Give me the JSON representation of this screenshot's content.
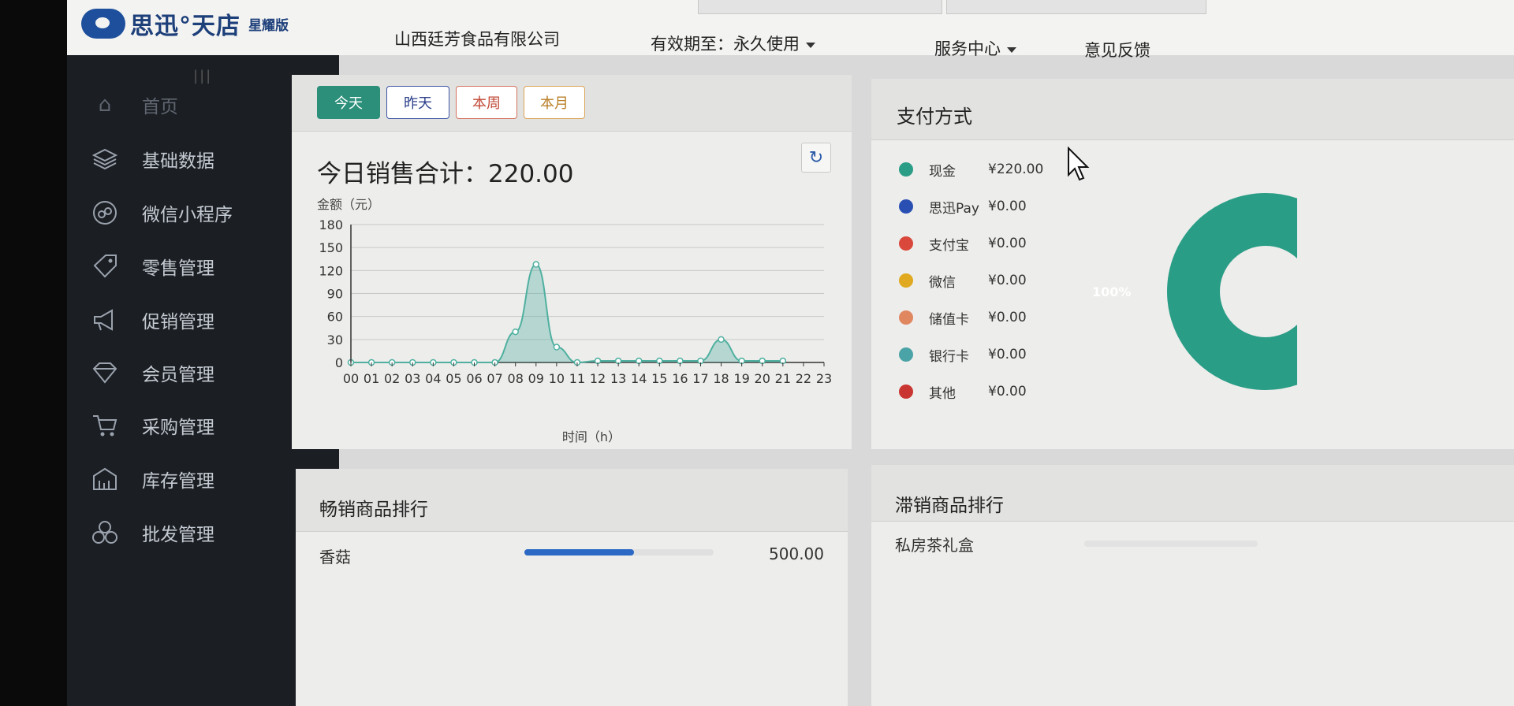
{
  "header": {
    "brand": "思迅°天店",
    "edition": "星耀版",
    "company": "山西廷芳食品有限公司",
    "validity_label": "有效期至：",
    "validity_value": "永久使用",
    "service_center": "服务中心",
    "feedback": "意见反馈"
  },
  "sidebar": {
    "items": [
      {
        "label": "首页",
        "icon": "home-icon"
      },
      {
        "label": "基础数据",
        "icon": "layers-icon"
      },
      {
        "label": "微信小程序",
        "icon": "miniprogram-icon"
      },
      {
        "label": "零售管理",
        "icon": "tag-icon"
      },
      {
        "label": "促销管理",
        "icon": "megaphone-icon"
      },
      {
        "label": "会员管理",
        "icon": "diamond-icon"
      },
      {
        "label": "采购管理",
        "icon": "cart-icon"
      },
      {
        "label": "库存管理",
        "icon": "warehouse-icon"
      },
      {
        "label": "批发管理",
        "icon": "cubes-icon"
      }
    ]
  },
  "sales": {
    "period_buttons": [
      "今天",
      "昨天",
      "本周",
      "本月"
    ],
    "selected_period": "今天",
    "total_label": "今日销售合计：",
    "total_value": "220.00"
  },
  "chart_data": {
    "type": "area",
    "ylabel": "金额（元）",
    "xlabel": "时间（h）",
    "ylim": [
      0,
      180
    ],
    "yticks": [
      0,
      30,
      60,
      90,
      120,
      150,
      180
    ],
    "categories": [
      "00",
      "01",
      "02",
      "03",
      "04",
      "05",
      "06",
      "07",
      "08",
      "09",
      "10",
      "11",
      "12",
      "13",
      "14",
      "15",
      "16",
      "17",
      "18",
      "19",
      "20",
      "21",
      "22",
      "23"
    ],
    "series": [
      {
        "values": [
          0,
          0,
          0,
          0,
          0,
          0,
          0,
          0,
          40,
          128,
          20,
          0,
          2,
          2,
          2,
          2,
          2,
          2,
          30,
          2,
          2,
          2,
          null,
          null
        ]
      }
    ],
    "grid": true,
    "color": "#4fb0a0"
  },
  "payment": {
    "title": "支付方式",
    "methods": [
      {
        "name": "现金",
        "amount": "¥220.00",
        "color": "#2a9d86"
      },
      {
        "name": "思迅Pay",
        "amount": "¥0.00",
        "color": "#2a4fb3"
      },
      {
        "name": "支付宝",
        "amount": "¥0.00",
        "color": "#d9483b"
      },
      {
        "name": "微信",
        "amount": "¥0.00",
        "color": "#e0a91f"
      },
      {
        "name": "储值卡",
        "amount": "¥0.00",
        "color": "#e08760"
      },
      {
        "name": "银行卡",
        "amount": "¥0.00",
        "color": "#4aa3a6"
      },
      {
        "name": "其他",
        "amount": "¥0.00",
        "color": "#c93530"
      }
    ],
    "donut_label": "100%",
    "donut_share": 1.0
  },
  "top_sellers": {
    "title": "畅销商品排行",
    "items": [
      {
        "name": "香菇",
        "value": "500.00",
        "share": 0.58
      }
    ]
  },
  "slow_sellers": {
    "title": "滞销商品排行",
    "items": [
      {
        "name": "私房茶礼盒"
      }
    ]
  }
}
